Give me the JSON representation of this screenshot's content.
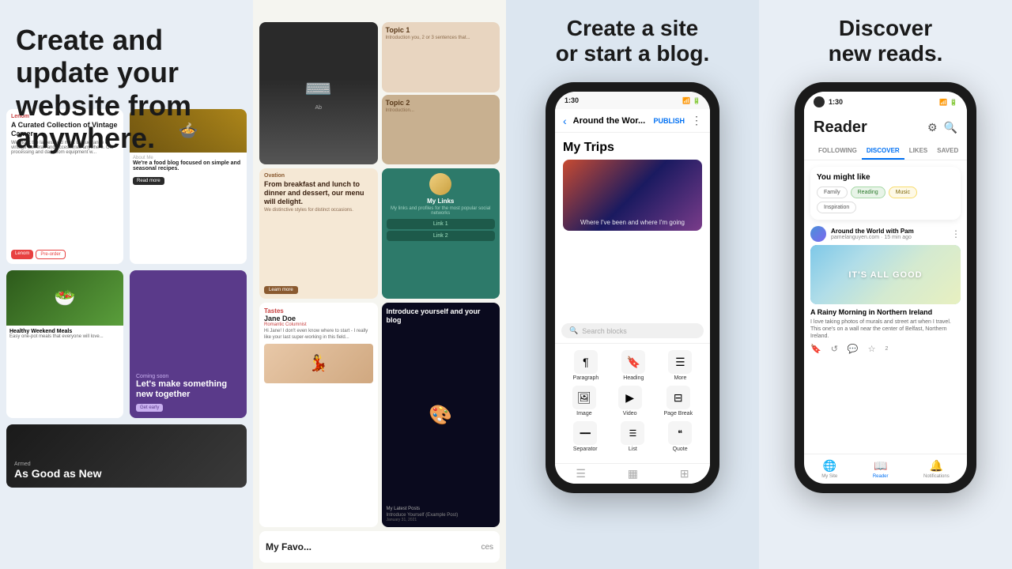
{
  "section1": {
    "headline": "Create and\nupdate your\nwebsite from\nanywhere."
  },
  "section2": {
    "cards": [
      {
        "label": "Lenom",
        "title": "A Curated Collection of Vintage Camer",
        "style": "white"
      },
      {
        "label": "About me",
        "subtitle": "We're a food blog focused on simple and seasonal recipes.",
        "style": "food"
      },
      {
        "label": "Ovation",
        "title": "From breakfast and lunch to dinner and dessert, our menu will delight.",
        "style": "salmon"
      },
      {
        "label": "My Links",
        "title": "My links and profiles",
        "style": "teal"
      },
      {
        "label": "Topic 1",
        "style": "beige"
      },
      {
        "label": "Topic 2",
        "style": "olive"
      },
      {
        "label": "As Good as New",
        "style": "dark"
      },
      {
        "label": "Jane Doe",
        "subtitle": "Romantic Columnist",
        "style": "white"
      },
      {
        "label": "Introduce yourself and your blog",
        "style": "dark-blue"
      },
      {
        "label": "My Favorites",
        "style": "white"
      }
    ]
  },
  "section3": {
    "headline": "Create a site\nor start a blog.",
    "phone": {
      "time": "1:30",
      "navBack": "‹",
      "navTitle": "Around the Wor...",
      "publishBtn": "PUBLISH",
      "pageTitle": "My Trips",
      "heroCaptionText": "Where I've been and where I'm going",
      "searchPlaceholder": "Search blocks",
      "blocks": [
        {
          "icon": "¶",
          "label": "Paragraph"
        },
        {
          "icon": "🔖",
          "label": "Heading"
        },
        {
          "icon": "≡",
          "label": "More"
        },
        {
          "icon": "🖼",
          "label": "Image"
        },
        {
          "icon": "▶",
          "label": "Video"
        },
        {
          "icon": "⊟",
          "label": "Page Break"
        },
        {
          "icon": "☰",
          "label": "Separator"
        },
        {
          "icon": "☰",
          "label": "List"
        },
        {
          "icon": "❝",
          "label": "Quote"
        }
      ]
    }
  },
  "section4": {
    "headline": "Discover\nnew reads.",
    "phone": {
      "time": "1:30",
      "appTitle": "Reader",
      "tabs": [
        "FOLLOWING",
        "DISCOVER",
        "LIKES",
        "SAVED"
      ],
      "activeTab": "DISCOVER",
      "youMightLike": "You might like",
      "pills": [
        "Family",
        "Reading",
        "Music",
        "Inspiration"
      ],
      "activePill": "Reading",
      "article": {
        "authorName": "Around the World with Pam",
        "authorDomain": "pamelanguyen.com · 15 min ago",
        "heroText": "IT'S ALL GOOD",
        "title": "A Rainy Morning in Northern Ireland",
        "excerpt": "I love taking photos of murals and street art when I travel. This one's on a wall near the center of Belfast, Northern Ireland.",
        "likeCount": "2"
      },
      "bottomNav": [
        {
          "icon": "🌐",
          "label": "My Site"
        },
        {
          "icon": "📖",
          "label": "Reader"
        },
        {
          "icon": "🔔",
          "label": "Notifications"
        }
      ],
      "activeNav": "Reader"
    }
  }
}
